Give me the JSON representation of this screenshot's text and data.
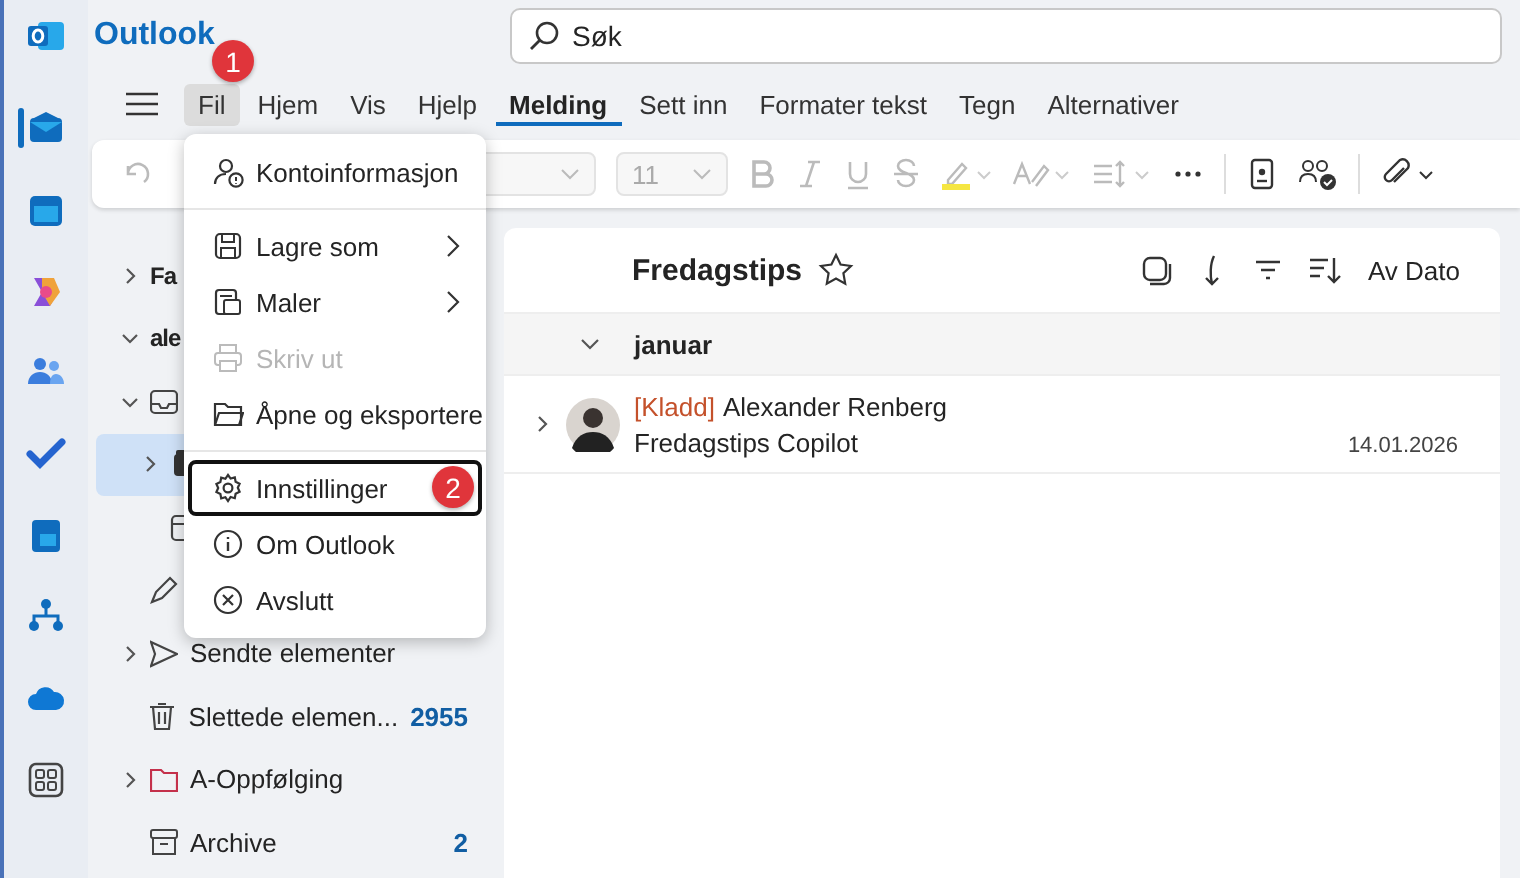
{
  "app": {
    "title": "Outlook"
  },
  "search": {
    "value": "Søk"
  },
  "rail": [
    {
      "kind": "mail",
      "selected": true
    },
    {
      "kind": "calendar",
      "selected": false
    },
    {
      "kind": "copilot",
      "selected": false
    },
    {
      "kind": "people",
      "selected": false
    },
    {
      "kind": "todo",
      "selected": false
    },
    {
      "kind": "forms",
      "selected": false
    },
    {
      "kind": "org",
      "selected": false
    },
    {
      "kind": "cloud",
      "selected": false
    },
    {
      "kind": "apps",
      "selected": false
    }
  ],
  "tabs": [
    {
      "label": "Fil",
      "selected": false,
      "open": true,
      "badge": "1"
    },
    {
      "label": "Hjem",
      "selected": false,
      "open": false
    },
    {
      "label": "Vis",
      "selected": false,
      "open": false
    },
    {
      "label": "Hjelp",
      "selected": false,
      "open": false
    },
    {
      "label": "Melding",
      "selected": true,
      "open": false
    },
    {
      "label": "Sett inn",
      "selected": false,
      "open": false
    },
    {
      "label": "Formater tekst",
      "selected": false,
      "open": false
    },
    {
      "label": "Tegn",
      "selected": false,
      "open": false
    },
    {
      "label": "Alternativer",
      "selected": false,
      "open": false
    }
  ],
  "toolbar": {
    "font_size": "11"
  },
  "folders": [
    {
      "label": "Fa",
      "kind": "group",
      "expanded": false,
      "selected": false
    },
    {
      "label": "ale",
      "kind": "group",
      "expanded": true,
      "selected": false,
      "children": [
        {
          "kind": "inbox",
          "expanded": true,
          "selected": false,
          "children": [
            {
              "kind": "drawer",
              "expanded": false,
              "selected": true
            },
            {
              "kind": "box",
              "selected": false
            }
          ]
        },
        {
          "kind": "draft",
          "selected": false
        },
        {
          "label": "Sendte elementer",
          "kind": "sent",
          "expanded": false,
          "selected": false
        },
        {
          "label": "Slettede elemen...",
          "kind": "trash",
          "count": "2955",
          "selected": false
        },
        {
          "label": "A-Oppfølging",
          "kind": "folder",
          "expanded": false,
          "selected": false
        },
        {
          "label": "Archive",
          "kind": "archive",
          "count": "2",
          "selected": false
        }
      ]
    }
  ],
  "menu": {
    "sections": [
      [
        {
          "label": "Kontoinformasjon",
          "kind": "account",
          "submenu": false,
          "disabled": false,
          "focused": false
        }
      ],
      [
        {
          "label": "Lagre som",
          "kind": "save",
          "submenu": true,
          "disabled": false,
          "focused": false
        },
        {
          "label": "Maler",
          "kind": "templates",
          "submenu": true,
          "disabled": false,
          "focused": false
        },
        {
          "label": "Skriv ut",
          "kind": "print",
          "submenu": false,
          "disabled": true,
          "focused": false
        },
        {
          "label": "Åpne og eksportere",
          "kind": "folder",
          "submenu": false,
          "disabled": false,
          "focused": false
        }
      ],
      [
        {
          "label": "Innstillinger",
          "kind": "gear",
          "submenu": false,
          "disabled": false,
          "focused": true,
          "badge": "2"
        },
        {
          "label": "Om Outlook",
          "kind": "info",
          "submenu": false,
          "disabled": false,
          "focused": false
        },
        {
          "label": "Avslutt",
          "kind": "exit",
          "submenu": false,
          "disabled": false,
          "focused": false
        }
      ]
    ]
  },
  "mail_list": {
    "title": "Fredagstips",
    "sort_label": "Av Dato",
    "groups": [
      {
        "label": "januar",
        "expanded": true,
        "messages": [
          {
            "tag": "[Kladd]",
            "sender": "Alexander Renberg",
            "subject": "Fredagstips Copilot",
            "date": "14.01.2026",
            "expanded": false,
            "selected": false
          }
        ]
      }
    ]
  }
}
